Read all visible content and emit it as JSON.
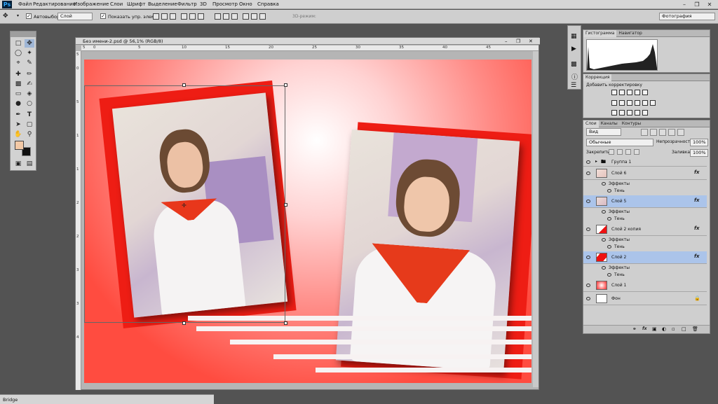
{
  "menubar": {
    "logo": "Ps",
    "items": [
      "Файл",
      "Редактирование",
      "Изображение",
      "Слои",
      "Шрифт",
      "Выделение",
      "Фильтр",
      "3D",
      "Просмотр",
      "Окно",
      "Справка"
    ]
  },
  "options": {
    "autoselect_label": "Автовыбор:",
    "autoselect_value": "Слой",
    "show_controls_label": "Показать упр. элем.",
    "mode3d_label": "3D-режим:",
    "workspace": "Фотография"
  },
  "document": {
    "tab_title": "Без имени-2.psd @ 56,1% (RGB/8)",
    "ruler_top": [
      "5",
      "0",
      "5",
      "10",
      "15",
      "20",
      "25",
      "30",
      "35",
      "40",
      "45"
    ],
    "ruler_left": [
      "5",
      "0",
      "5",
      "1",
      "1",
      "2",
      "2",
      "3",
      "3",
      "4"
    ]
  },
  "panels": {
    "histogram_tab": "Гистограмма",
    "navigator_tab": "Навигатор",
    "correction_tab": "Коррекция",
    "add_correction": "Добавить корректировку",
    "layers_tab": "Слои",
    "channels_tab": "Каналы",
    "paths_tab": "Контуры",
    "kind_label": "Вид",
    "blend_mode": "Обычные",
    "opacity_label": "Непрозрачность:",
    "opacity_value": "100%",
    "lock_label": "Закрепить:",
    "fill_label": "Заливка:",
    "fill_value": "100%"
  },
  "layers": [
    {
      "name": "Группа 1",
      "type": "group"
    },
    {
      "name": "Слой 6",
      "type": "layer",
      "fx": "fx",
      "selected": false,
      "effects_label": "Эффекты",
      "effect": "Тень"
    },
    {
      "name": "Слой 5",
      "type": "layer",
      "fx": "fx",
      "selected": true,
      "effects_label": "Эффекты",
      "effect": "Тень"
    },
    {
      "name": "Слой 2 копия",
      "type": "layer",
      "fx": "fx",
      "selected": false,
      "effects_label": "Эффекты",
      "effect": "Тень"
    },
    {
      "name": "Слой 2",
      "type": "layer",
      "fx": "fx",
      "selected": true,
      "effects_label": "Эффекты",
      "effect": "Тень"
    },
    {
      "name": "Слой 1",
      "type": "layer"
    },
    {
      "name": "Фон",
      "type": "background"
    }
  ],
  "bottombar": {
    "label": "Bridge"
  },
  "colors": {
    "foreground": "#f3c9a6",
    "background": "#111111",
    "accent": "#ee1d14"
  }
}
